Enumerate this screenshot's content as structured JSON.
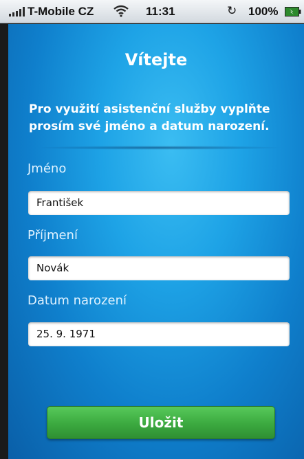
{
  "status_bar": {
    "carrier": "T-Mobile CZ",
    "time": "11:31",
    "battery_percent": "100%",
    "icons": [
      "signal-icon",
      "wifi-icon",
      "sync-icon",
      "battery-icon"
    ]
  },
  "screen": {
    "title": "Vítejte",
    "intro": "Pro využití asistenční služby vyplňte prosím své jméno a datum narození.",
    "fields": [
      {
        "label": "Jméno",
        "value": "František"
      },
      {
        "label": "Příjmení",
        "value": "Novák"
      },
      {
        "label": "Datum narození",
        "value": "25. 9. 1971"
      }
    ],
    "save_label": "Uložit"
  },
  "colors": {
    "background_blue": "#1ea3e6",
    "button_green": "#3ba93f",
    "text_white": "#ffffff"
  }
}
